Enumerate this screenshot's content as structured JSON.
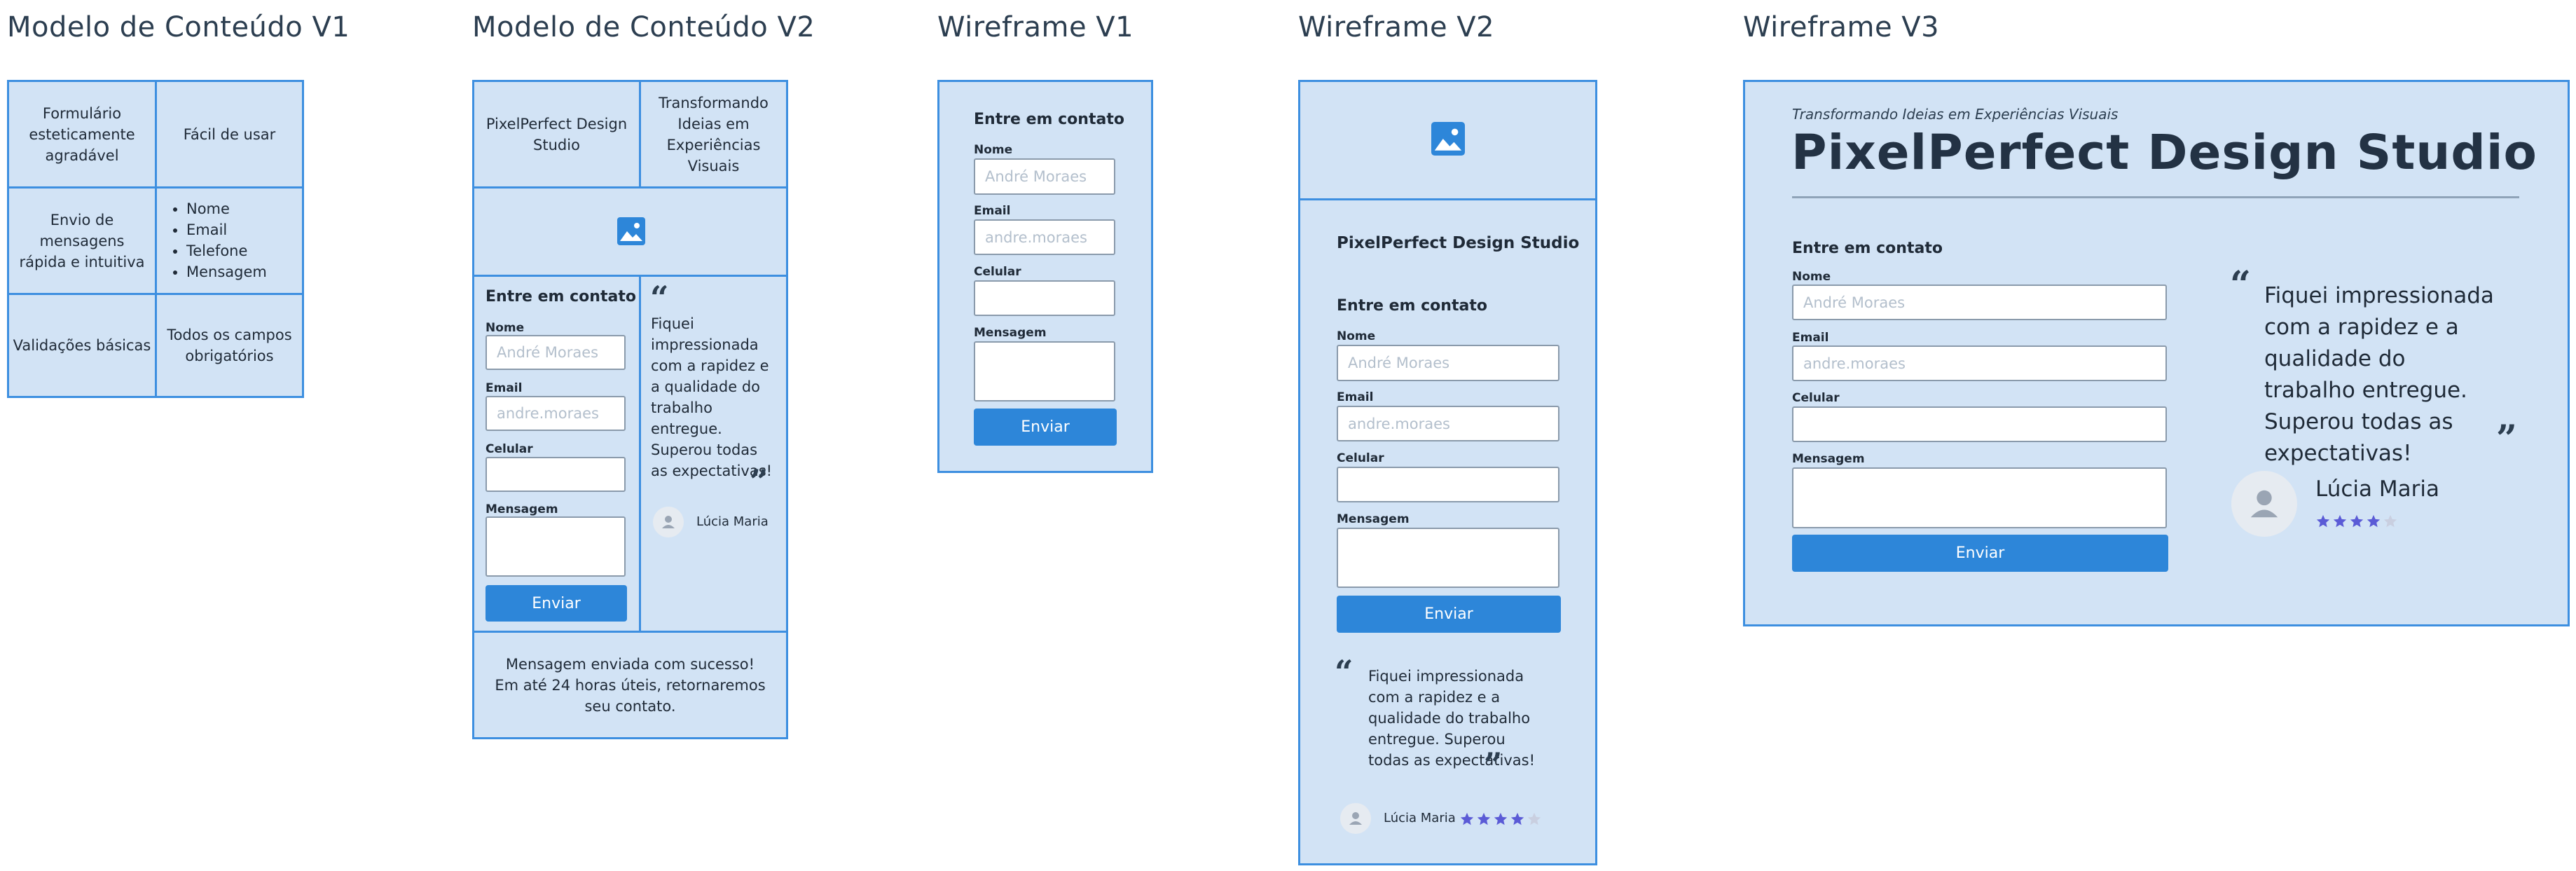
{
  "frames": {
    "v1_model": {
      "title": "Modelo de Conteúdo V1",
      "cells": [
        "Formulário esteticamente agradável",
        "Fácil de usar",
        "Envio de mensagens rápida e intuitiva",
        "Validações básicas",
        "Todos os campos obrigatórios"
      ],
      "fields_list": [
        "Nome",
        "Email",
        "Telefone",
        "Mensagem"
      ]
    },
    "v2_model": {
      "title": "Modelo de Conteúdo V2",
      "brand": "PixelPerfect Design Studio",
      "tagline": "Transformando Ideias em Experiências Visuais",
      "success_line1": "Mensagem enviada com sucesso!",
      "success_line2": "Em até 24 horas úteis, retornaremos seu contato."
    },
    "wf1": {
      "title": "Wireframe V1"
    },
    "wf2": {
      "title": "Wireframe V2",
      "brand": "PixelPerfect Design Studio"
    },
    "wf3": {
      "title": "Wireframe V3",
      "tagline": "Transformando Ideias em Experiências Visuais",
      "brand": "PixelPerfect Design Studio"
    }
  },
  "form": {
    "heading": "Entre em contato",
    "name_label": "Nome",
    "name_placeholder": "André Moraes",
    "email_label": "Email",
    "email_placeholder": "andre.moraes",
    "phone_label": "Celular",
    "message_label": "Mensagem",
    "submit_label": "Enviar"
  },
  "testimonial": {
    "quote": "Fiquei impressionada com a rapidez e a qualidade do trabalho entregue. Superou todas as expectativas!",
    "author": "Lúcia Maria",
    "rating": 4,
    "rating_max": 5
  },
  "colors": {
    "panel_bg": "#d2e3f5",
    "border": "#3d8fe0",
    "button": "#2d86d9",
    "star_filled": "#5b5bd6",
    "star_empty": "#c9cfe0"
  },
  "icons": [
    "image-icon",
    "user-icon",
    "quote-open-icon",
    "quote-close-icon",
    "star-icon"
  ]
}
